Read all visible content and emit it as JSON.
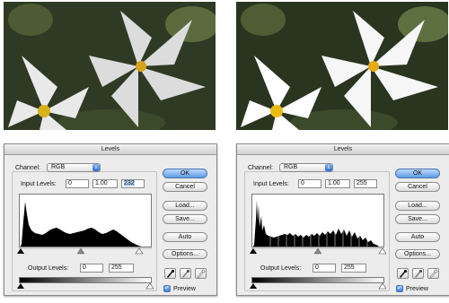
{
  "colors": {
    "accent": "#3d7fd8",
    "histogram_fill": "#000000",
    "selection": "#b5d3f7"
  },
  "dialogs": [
    {
      "title": "Levels",
      "channel_label": "Channel:",
      "channel_value": "RGB",
      "input_levels_label": "Input Levels:",
      "input_black": "0",
      "input_gamma": "1.00",
      "input_white": "232",
      "output_levels_label": "Output Levels:",
      "output_black": "0",
      "output_white": "255",
      "buttons": [
        "OK",
        "Cancel",
        "Load...",
        "Save...",
        "Auto",
        "Options..."
      ],
      "preview_label": "Preview",
      "preview_checked": true,
      "histogram": "original"
    },
    {
      "title": "Levels",
      "channel_label": "Channel:",
      "channel_value": "RGB",
      "input_levels_label": "Input Levels:",
      "input_black": "0",
      "input_gamma": "1.00",
      "input_white": "255",
      "output_levels_label": "Output Levels:",
      "output_black": "0",
      "output_white": "255",
      "buttons": [
        "OK",
        "Cancel",
        "Load...",
        "Save...",
        "Auto",
        "Options..."
      ],
      "preview_label": "Preview",
      "preview_checked": true,
      "histogram": "stretched"
    }
  ],
  "icons": {
    "popup_arrows": "updown-arrows-icon",
    "eyedroppers": [
      "black-eyedropper-icon",
      "gray-eyedropper-icon",
      "white-eyedropper-icon"
    ],
    "preview_check": "checkmark-icon"
  }
}
